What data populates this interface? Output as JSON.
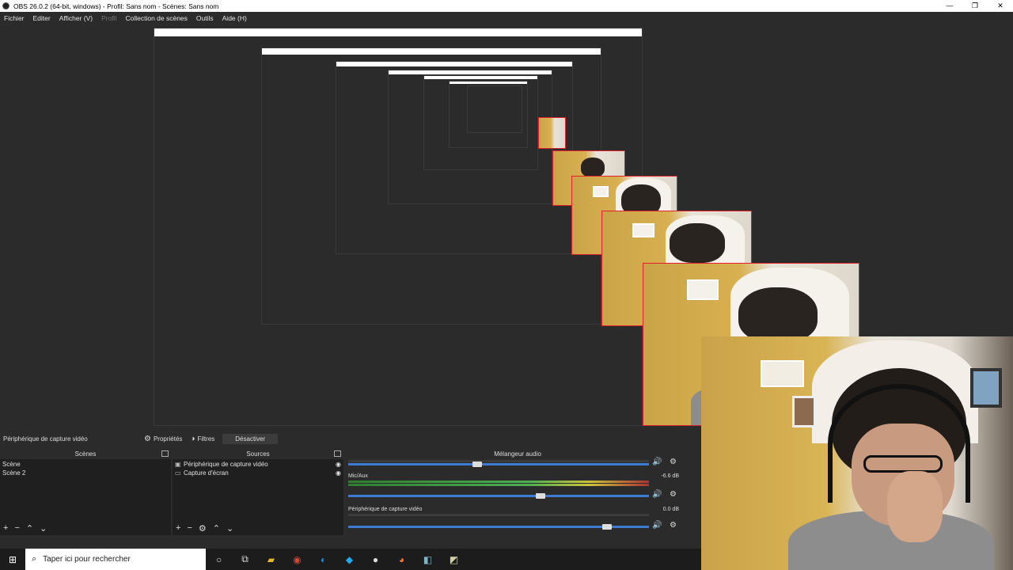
{
  "window": {
    "title": "OBS 26.0.2 (64-bit, windows) - Profil: Sans nom - Scènes: Sans nom",
    "controls": [
      "—",
      "❐",
      "✕"
    ]
  },
  "menu": {
    "fichier": "Fichier",
    "editer": "Editer",
    "afficher": "Afficher (V)",
    "profil": "Profil",
    "collection": "Collection de scènes",
    "outils": "Outils",
    "aide": "Aide (H)"
  },
  "context_bar": {
    "source_name": "Périphérique de capture vidéo",
    "properties": "Propriétés",
    "filters": "Filtres",
    "deactivate": "Désactiver"
  },
  "scenes": {
    "header": "Scènes",
    "items": [
      "Scène",
      "Scène 2"
    ]
  },
  "sources": {
    "header": "Sources",
    "items": [
      "Périphérique de capture vidéo",
      "Capture d'écran"
    ]
  },
  "mixer": {
    "header": "Mélangeur audio",
    "channels": [
      {
        "name": "Mic/Aux",
        "db": "-6.6 dB",
        "volume": 0.64
      },
      {
        "name": "Périphérique de capture vidéo",
        "db": "0.0 dB",
        "volume": 0.86
      }
    ],
    "desktop_volume": 0.43
  },
  "taskbar": {
    "search_placeholder": "Taper ici pour rechercher",
    "icons": [
      "cortana-icon",
      "task-view-icon",
      "explorer-icon",
      "chrome-icon",
      "edge-icon",
      "vscode-icon",
      "obs-icon",
      "firefox-icon",
      "app-icon",
      "app2-icon"
    ]
  }
}
